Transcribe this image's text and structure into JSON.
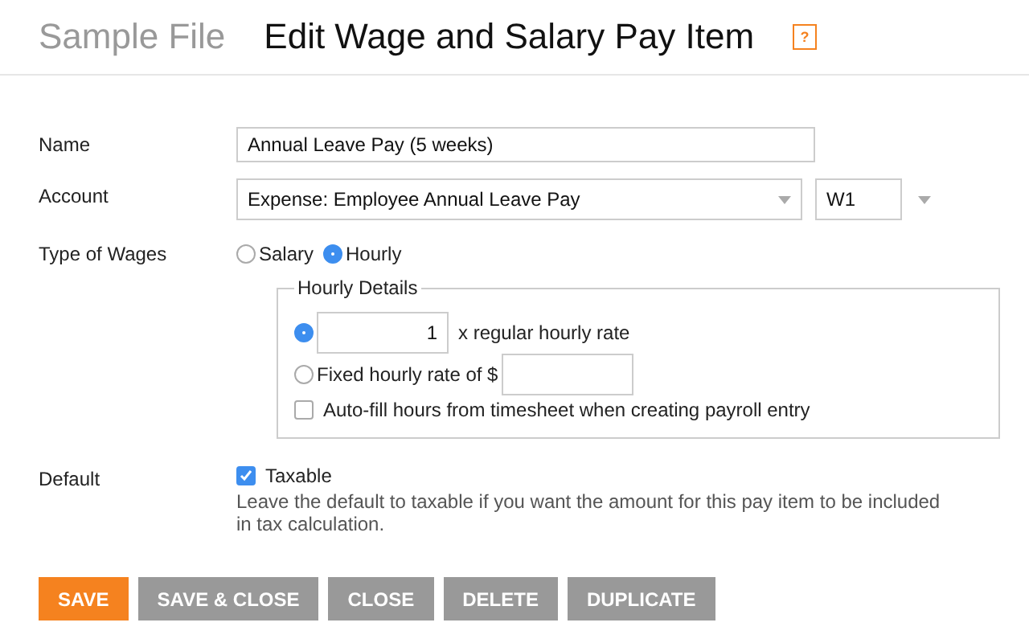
{
  "header": {
    "file_name": "Sample File",
    "title": "Edit Wage and Salary Pay Item",
    "help": "?"
  },
  "fields": {
    "name": {
      "label": "Name",
      "value": "Annual Leave Pay (5 weeks)"
    },
    "account": {
      "label": "Account",
      "value": "Expense: Employee Annual Leave Pay",
      "code": "W1"
    },
    "wage_type": {
      "label": "Type of Wages",
      "options": [
        {
          "label": "Salary",
          "selected": false
        },
        {
          "label": "Hourly",
          "selected": true
        }
      ]
    },
    "hourly_details": {
      "legend": "Hourly Details",
      "rates": [
        {
          "kind": "multiplier",
          "selected": true,
          "value": "1",
          "label": "x regular hourly rate"
        },
        {
          "kind": "fixed",
          "selected": false,
          "label": "Fixed hourly rate of $"
        }
      ],
      "autofill": {
        "label": "Auto-fill hours from timesheet when creating payroll entry",
        "checked": false
      }
    },
    "default": {
      "label": "Default",
      "taxable": {
        "label": "Taxable",
        "checked": true
      },
      "help": "Leave the default to taxable if you want the amount for this pay item to be included in tax calculation."
    }
  },
  "buttons": [
    {
      "label": "SAVE",
      "kind": "primary"
    },
    {
      "label": "SAVE & CLOSE",
      "kind": "secondary"
    },
    {
      "label": "CLOSE",
      "kind": "secondary"
    },
    {
      "label": "DELETE",
      "kind": "secondary"
    },
    {
      "label": "DUPLICATE",
      "kind": "secondary"
    }
  ]
}
